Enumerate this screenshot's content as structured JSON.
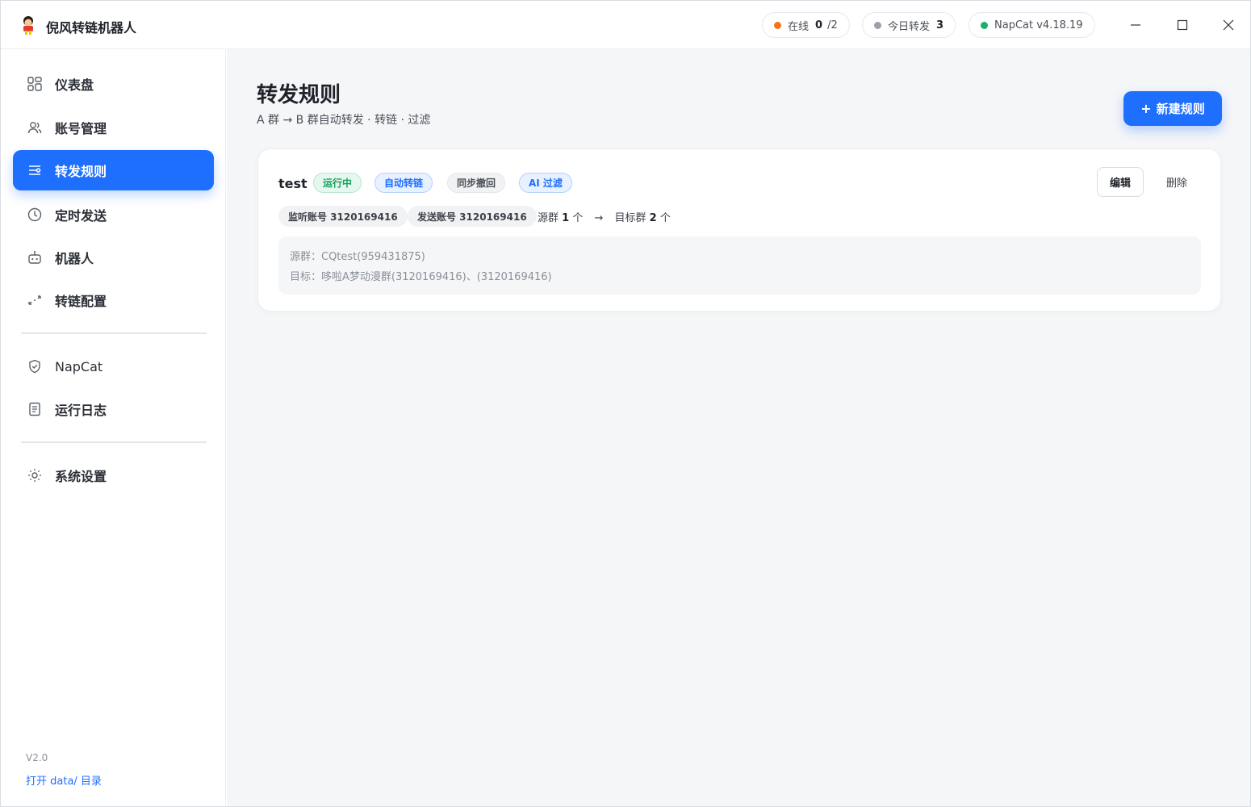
{
  "app": {
    "title": "倪风转链机器人"
  },
  "status": {
    "online_label": "在线",
    "online_count": "0",
    "online_total": "/2",
    "forward_label": "今日转发",
    "forward_count": "3",
    "napcat_label": "NapCat v4.18.19",
    "colors": {
      "online": "#f5761a",
      "forward": "#9aa0a8",
      "napcat": "#18b26b"
    }
  },
  "sidebar": {
    "items": [
      {
        "label": "仪表盘",
        "icon": "dashboard-icon"
      },
      {
        "label": "账号管理",
        "icon": "users-icon"
      },
      {
        "label": "转发规则",
        "icon": "sliders-icon"
      },
      {
        "label": "定时发送",
        "icon": "clock-icon"
      },
      {
        "label": "机器人",
        "icon": "robot-icon"
      },
      {
        "label": "转链配置",
        "icon": "link-convert-icon"
      },
      {
        "label": "NapCat",
        "icon": "shield-icon"
      },
      {
        "label": "运行日志",
        "icon": "log-icon"
      },
      {
        "label": "系统设置",
        "icon": "sun-settings-icon"
      }
    ],
    "version": "V2.0",
    "open_dir": "打开 data/ 目录"
  },
  "page": {
    "title": "转发规则",
    "subtitle": "A 群 → B 群自动转发 · 转链 · 过滤",
    "new_rule_label": "新建规则"
  },
  "rule": {
    "name": "test",
    "tags": [
      "运行中",
      "自动转链",
      "同步撤回",
      "AI 过滤"
    ],
    "listen_account": "监听账号 3120169416",
    "send_account": "发送账号 3120169416",
    "source_prefix": "源群 ",
    "source_count": "1",
    "source_suffix": " 个",
    "arrow": "→",
    "target_prefix": "目标群 ",
    "target_count": "2",
    "target_suffix": " 个",
    "edit_label": "编辑",
    "delete_label": "删除",
    "source_detail": "源群：CQtest(959431875)",
    "target_detail": "目标：哆啦A梦动漫群(3120169416)、(3120169416)"
  }
}
